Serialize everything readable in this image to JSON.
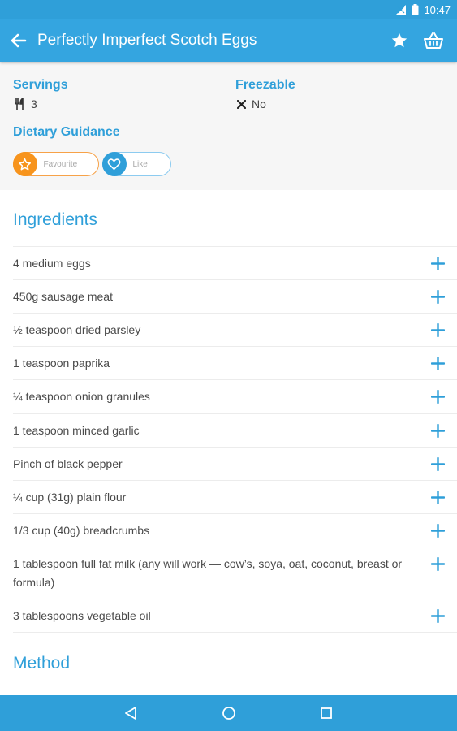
{
  "status_bar": {
    "time": "10:47"
  },
  "app_bar": {
    "title": "Perfectly Imperfect Scotch Eggs"
  },
  "info": {
    "servings_label": "Servings",
    "servings_value": "3",
    "freezable_label": "Freezable",
    "freezable_value": "No",
    "dietary_label": "Dietary Guidance",
    "favourite_label": "Favourite",
    "like_label": "Like"
  },
  "ingredients": {
    "title": "Ingredients",
    "items": [
      "4 medium eggs",
      "450g sausage meat",
      "½ teaspoon dried parsley",
      "1 teaspoon paprika",
      "¼ teaspoon onion granules",
      "1 teaspoon minced garlic",
      "Pinch of black pepper",
      "¼ cup (31g) plain flour",
      "1/3 cup (40g) breadcrumbs",
      "1 tablespoon full fat milk (any will work — cow’s, soya, oat, coconut, breast or formula)",
      "3 tablespoons vegetable oil"
    ]
  },
  "method": {
    "title": "Method"
  },
  "colors": {
    "primary": "#34a5e0",
    "accent": "#f7941d",
    "text": "#4a4a4a"
  },
  "icons": [
    "back-arrow-icon",
    "star-icon",
    "basket-icon",
    "cutlery-icon",
    "cross-icon",
    "star-outline-icon",
    "heart-outline-icon",
    "plus-icon",
    "nav-back-icon",
    "nav-home-icon",
    "nav-recents-icon"
  ]
}
